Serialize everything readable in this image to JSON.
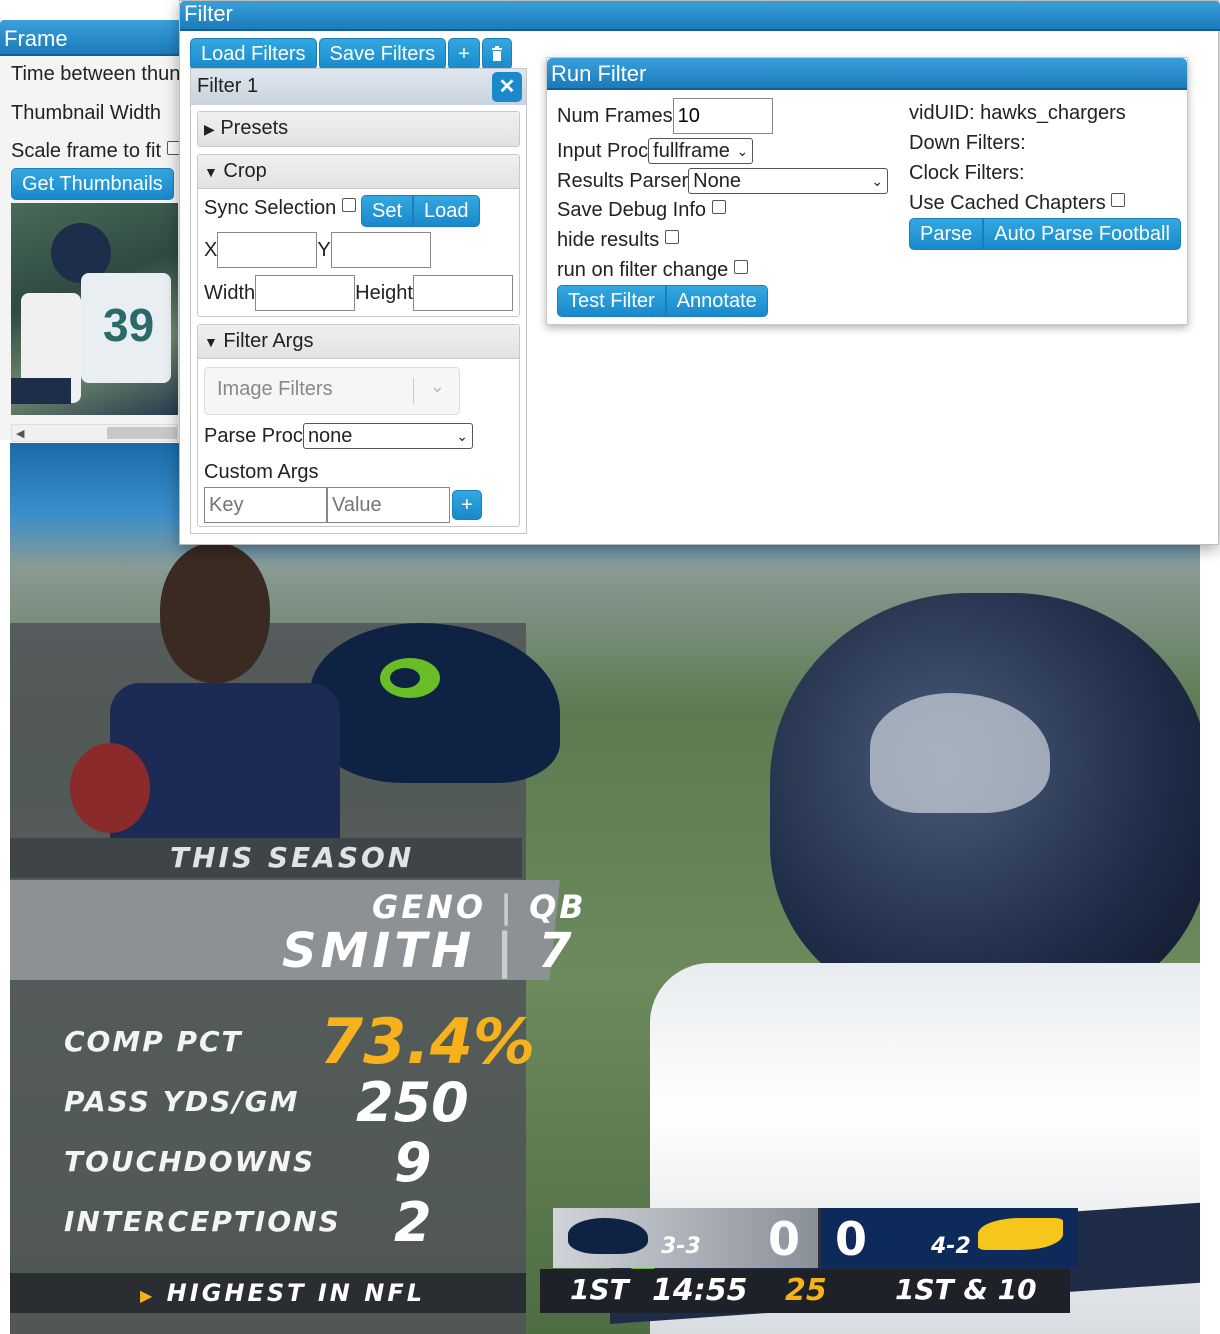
{
  "frame_panel": {
    "title": "Frame",
    "time_between_label": "Time between thun",
    "thumbnail_width_label": "Thumbnail Width",
    "scale_frame_label": "Scale frame to fit",
    "get_thumbnails_label": "Get Thumbnails"
  },
  "filter_window": {
    "title": "Filter",
    "toolbar": {
      "load_filters": "Load Filters",
      "save_filters": "Save Filters",
      "add": "+",
      "delete_icon": "trash-icon"
    },
    "filter1": {
      "title": "Filter 1",
      "close": "✕",
      "presets_label": "Presets",
      "crop": {
        "label": "Crop",
        "sync_selection_label": "Sync Selection",
        "set_label": "Set",
        "load_label": "Load",
        "x_label": "X",
        "y_label": "Y",
        "width_label": "Width",
        "height_label": "Height"
      },
      "filter_args": {
        "label": "Filter Args",
        "image_filters_placeholder": "Image Filters",
        "parse_proc_label": "Parse Proc",
        "parse_proc_value": "none",
        "custom_args_label": "Custom Args",
        "key_placeholder": "Key",
        "value_placeholder": "Value",
        "add": "+"
      }
    },
    "run_filter": {
      "title": "Run Filter",
      "num_frames_label": "Num Frames",
      "num_frames_value": "10",
      "input_proc_label": "Input Proc",
      "input_proc_value": "fullframe",
      "results_parser_label": "Results Parser",
      "results_parser_value": "None",
      "save_debug_label": "Save Debug Info",
      "hide_results_label": "hide results",
      "run_on_change_label": "run on filter change",
      "test_filter_label": "Test Filter",
      "annotate_label": "Annotate",
      "viduid_label": "vidUID: hawks_chargers",
      "down_filters_label": "Down Filters:",
      "clock_filters_label": "Clock Filters:",
      "use_cached_label": "Use Cached Chapters",
      "parse_label": "Parse",
      "auto_parse_label": "Auto Parse Football"
    }
  },
  "broadcast": {
    "this_season": "THIS SEASON",
    "first_name": "GENO",
    "position": "QB",
    "last_name": "SMITH",
    "number": "7",
    "stats": [
      {
        "label": "COMP PCT",
        "value": "73.4%"
      },
      {
        "label": "PASS YDS/GM",
        "value": "250"
      },
      {
        "label": "TOUCHDOWNS",
        "value": "9"
      },
      {
        "label": "INTERCEPTIONS",
        "value": "2"
      }
    ],
    "footer": "HIGHEST IN NFL",
    "scoreboard": {
      "home_record": "3-3",
      "home_score": "0",
      "away_score": "0",
      "away_record": "4-2",
      "quarter": "1ST",
      "clock": "14:55",
      "play_clock": "25",
      "down_distance": "1ST & 10"
    },
    "colors": {
      "accent": "#f7b21b",
      "navy": "#0e2244",
      "seahawks_green": "#69be28"
    }
  }
}
